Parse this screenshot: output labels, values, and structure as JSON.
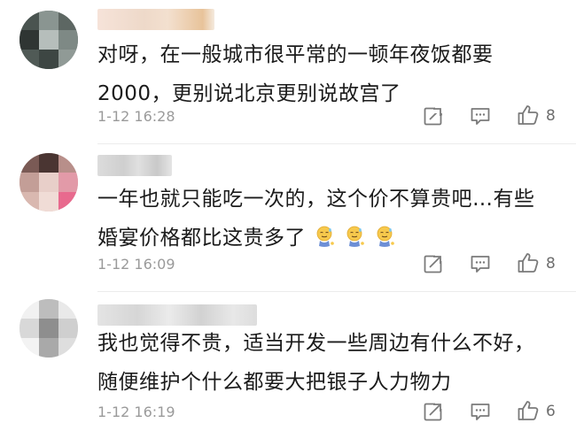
{
  "comments": [
    {
      "text_line1": "对呀，在一般城市很平常的一顿年夜饭都要",
      "text_line2": "2000，更别说北京更别说故宫了",
      "time": "1-12 16:28",
      "likes": "8"
    },
    {
      "text_line1": "一年也就只能吃一次的，这个价不算贵吧…有些",
      "text_line2": "婚宴价格都比这贵多了",
      "emojis": [
        "sweat-smile-emoji",
        "sweat-smile-emoji",
        "sweat-smile-emoji"
      ],
      "time": "1-12 16:09",
      "likes": "8"
    },
    {
      "text_line1": "我也觉得不贵，适当开发一些周边有什么不好，",
      "text_line2": "随便维护个什么都要大把银子人力物力",
      "time": "1-12 16:19",
      "likes": "6"
    }
  ],
  "colors": {
    "text": "#1b1b1b",
    "meta": "#9a9a9a",
    "icon": "#7a7a7a",
    "blur_name": "#e8e8e8"
  },
  "icons": [
    "forward-icon",
    "comment-icon",
    "like-icon"
  ]
}
